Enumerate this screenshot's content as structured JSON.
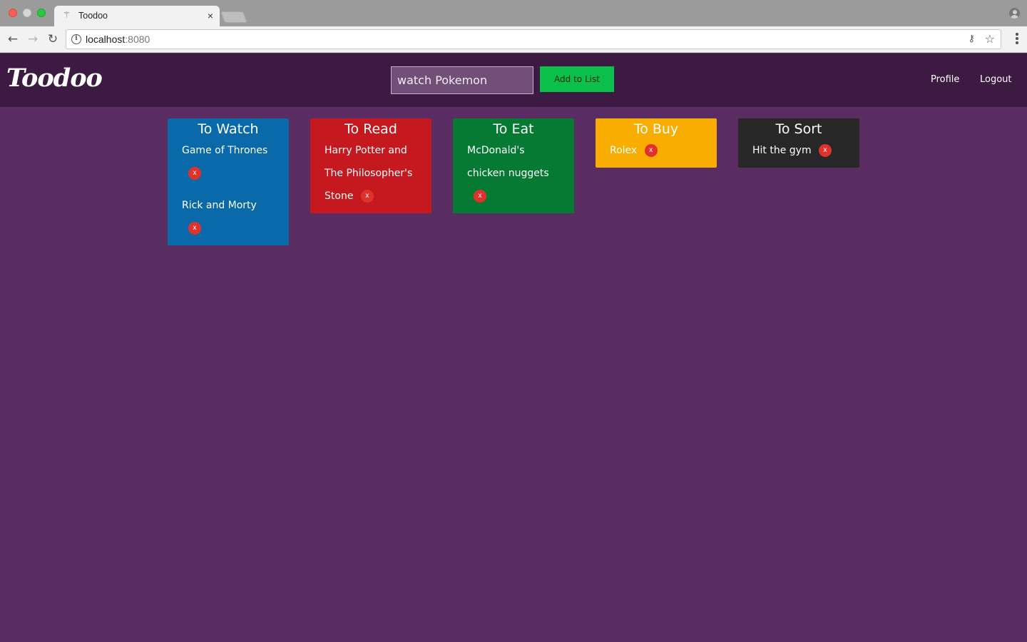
{
  "browser": {
    "tab_title": "Toodoo",
    "tab_close": "×",
    "url_host": "localhost",
    "url_port": ":8080"
  },
  "app": {
    "logo": "Toodoo",
    "input_value": "watch Pokemon",
    "add_button": "Add to List",
    "nav": {
      "profile": "Profile",
      "logout": "Logout"
    },
    "delete_label": "x",
    "lists": [
      {
        "title": "To Watch",
        "color": "#0a69a8",
        "items": [
          "Game of Thrones",
          "Rick and Morty"
        ]
      },
      {
        "title": "To Read",
        "color": "#c6191f",
        "items": [
          "Harry Potter and The Philosopher's Stone"
        ]
      },
      {
        "title": "To Eat",
        "color": "#067a33",
        "items": [
          "McDonald's chicken nuggets"
        ]
      },
      {
        "title": "To Buy",
        "color": "#f9ad00",
        "items": [
          "Rolex"
        ]
      },
      {
        "title": "To Sort",
        "color": "#272727",
        "items": [
          "Hit the gym"
        ]
      }
    ]
  }
}
